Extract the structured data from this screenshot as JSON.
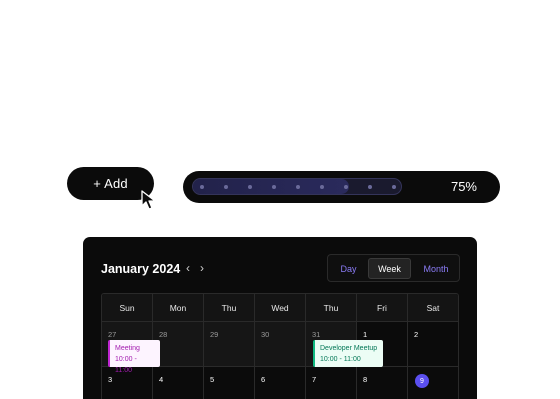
{
  "add_button": {
    "label": "+ Add"
  },
  "progress": {
    "value_label": "75%",
    "value": 0.75
  },
  "calendar": {
    "title": "January 2024",
    "prev_icon": "‹",
    "next_icon": "›",
    "views": {
      "day": "Day",
      "week": "Week",
      "month": "Month",
      "active": "Week"
    },
    "weekdays": [
      "Sun",
      "Mon",
      "Thu",
      "Wed",
      "Thu",
      "Fri",
      "Sat"
    ],
    "weeks": [
      [
        "27",
        "28",
        "29",
        "30",
        "31",
        "1",
        "2"
      ],
      [
        "3",
        "4",
        "5",
        "6",
        "7",
        "8",
        "9"
      ]
    ],
    "today": "9",
    "events": {
      "meeting": {
        "title": "Meeting",
        "time": "10:00 - 11:00"
      },
      "meetup": {
        "title": "Developer Meetup",
        "time": "10:00 - 11:00"
      }
    }
  },
  "colors": {
    "accent": "#5b4ff0",
    "view_link": "#8b7cf6",
    "meeting_text": "#a21caf",
    "meetup_text": "#047857"
  }
}
